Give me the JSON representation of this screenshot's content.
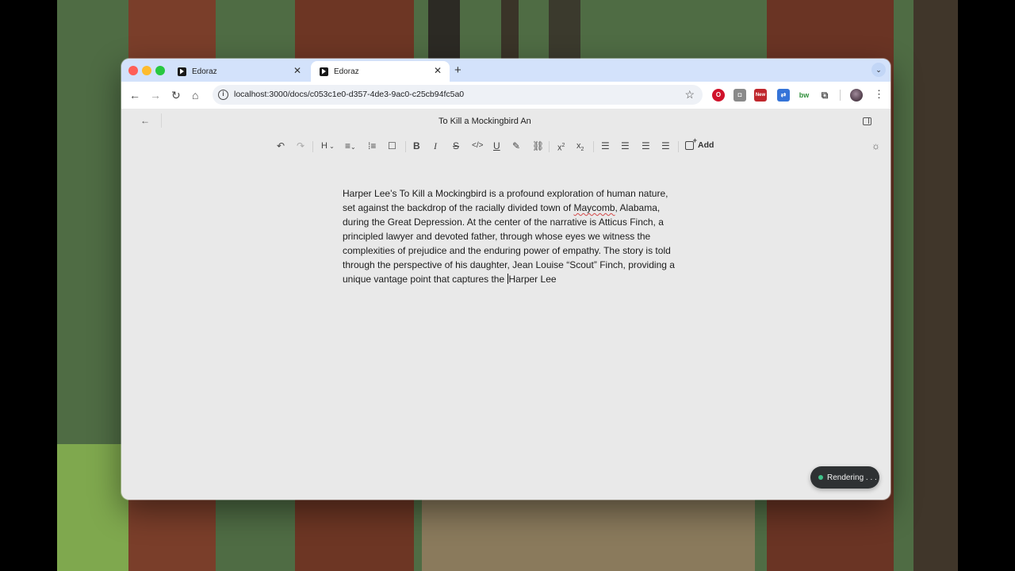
{
  "browser": {
    "tabs": [
      {
        "title": "Edoraz",
        "active": false
      },
      {
        "title": "Edoraz",
        "active": true
      }
    ],
    "url": "localhost:3000/docs/c053c1e0-d357-4de3-9ac0-c25cb94fc5a0",
    "extensions": [
      {
        "name": "opera-icon",
        "color": "#d0122a"
      },
      {
        "name": "camera-icon",
        "color": "#8a8a8a"
      },
      {
        "name": "new-extension-icon",
        "color": "#c0272d",
        "badge": "New"
      },
      {
        "name": "translate-icon",
        "color": "#3574d8"
      },
      {
        "name": "bw-icon",
        "color": "#2f8f3a",
        "label": "bw"
      },
      {
        "name": "puzzle-icon",
        "color": "#666666"
      }
    ]
  },
  "app": {
    "doc_title": "To Kill a Mockingbird An",
    "toolbar": {
      "heading_label": "H",
      "add_label": "Add"
    },
    "body": {
      "before_misspelled": "Harper Lee’s To Kill a Mockingbird is a profound exploration of human nature, set against the backdrop of the racially divided town of ",
      "misspelled": "Maycomb",
      "after_misspelled": ", Alabama, during the Great Depression. At the center of the narrative is Atticus Finch, a principled lawyer and devoted father, through whose eyes we witness the complexities of prejudice and the enduring power of empathy. The story is told through the perspective of his daughter, Jean Louise “Scout” Finch, providing a unique vantage point that captures the ",
      "after_caret": "Harper Lee"
    },
    "status_toast": "Rendering . . ."
  },
  "colors": {
    "tabbar_bg": "#d3e2fb",
    "page_bg": "#e9e9e9",
    "toast_bg": "#2e3133",
    "toast_dot": "#3fc28a",
    "traffic_red": "#ff5f57",
    "traffic_yellow": "#febc2e",
    "traffic_green": "#28c840"
  }
}
